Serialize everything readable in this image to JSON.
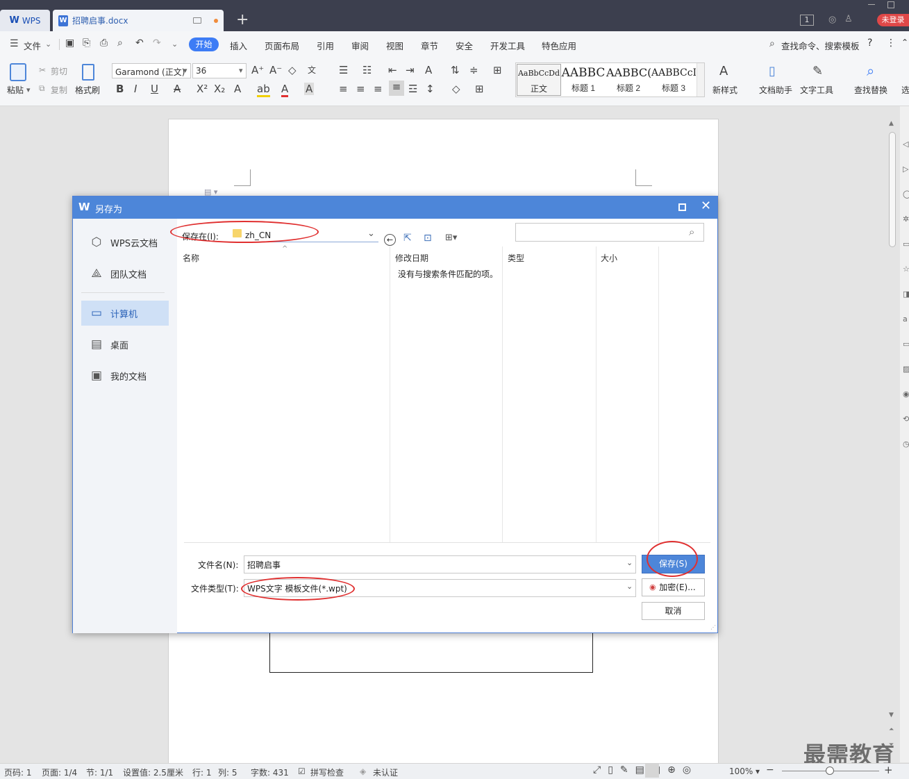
{
  "titlebar": {
    "app_tab": "WPS",
    "doc_tab": "招聘启事.docx",
    "login": "未登录",
    "badge": "1"
  },
  "menubar": {
    "file": "文件",
    "items": [
      "开始",
      "插入",
      "页面布局",
      "引用",
      "审阅",
      "视图",
      "章节",
      "安全",
      "开发工具",
      "特色应用"
    ],
    "search": "查找命令、搜索模板"
  },
  "ribbon": {
    "paste": "粘贴",
    "cut": "剪切",
    "copy": "复制",
    "format_painter": "格式刷",
    "font": "Garamond (正文)",
    "size": "36",
    "styles": [
      {
        "preview": "AaBbCcDd",
        "label": "正文"
      },
      {
        "preview": "AABBC",
        "label": "标题 1"
      },
      {
        "preview": "AABBC(",
        "label": "标题 2"
      },
      {
        "preview": "AABBCcI",
        "label": "标题 3"
      }
    ],
    "new_style": "新样式",
    "doc_assistant": "文档助手",
    "text_tools": "文字工具",
    "find_replace": "查找替换",
    "select": "选"
  },
  "dialog": {
    "title": "另存为",
    "sidebar": [
      "WPS云文档",
      "团队文档",
      "计算机",
      "桌面",
      "我的文档"
    ],
    "save_in_label": "保存在(I):",
    "save_in_value": "zh_CN",
    "search_placeholder": "",
    "columns": {
      "name": "名称",
      "modified": "修改日期",
      "type": "类型",
      "size": "大小"
    },
    "empty_msg": "没有与搜索条件匹配的项。",
    "filename_label": "文件名(N):",
    "filename_value": "招聘启事",
    "filetype_label": "文件类型(T):",
    "filetype_value": "WPS文字 模板文件(*.wpt)",
    "save_btn": "保存(S)",
    "encrypt_btn": "加密(E)...",
    "cancel_btn": "取消"
  },
  "status": {
    "page_code": "页码: 1",
    "pages": "页面: 1/4",
    "section": "节: 1/1",
    "setting": "设置值: 2.5厘米",
    "row": "行: 1",
    "col": "列: 5",
    "words": "字数: 431",
    "spell": "拼写检查",
    "cert": "未认证",
    "zoom": "100%"
  },
  "watermark": "最需教育",
  "colors": {
    "accent": "#3d7cf5",
    "title_blue": "#4d86d9",
    "annotation_red": "#e03030"
  }
}
